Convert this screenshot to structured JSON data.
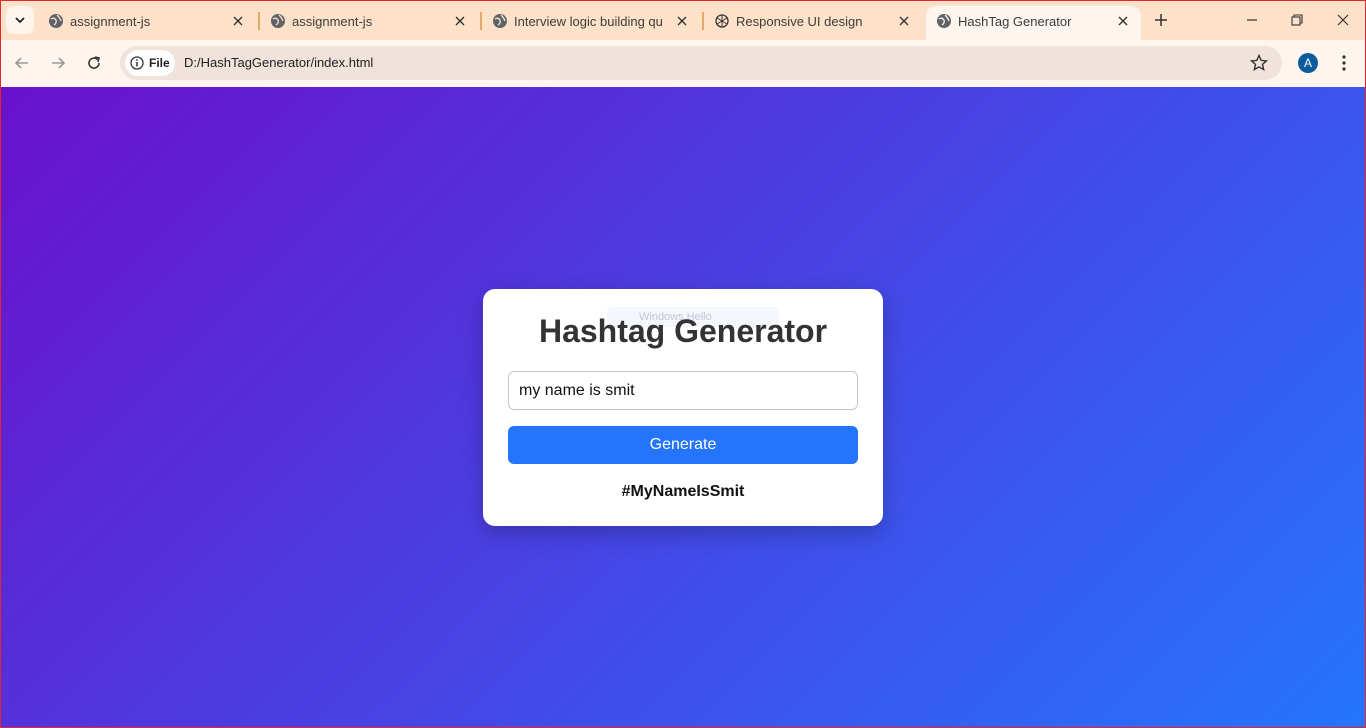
{
  "browser": {
    "tabs": [
      {
        "title": "assignment-js",
        "icon": "globe-icon",
        "active": false
      },
      {
        "title": "assignment-js",
        "icon": "globe-icon",
        "active": false
      },
      {
        "title": "Interview logic building questions",
        "icon": "globe-icon",
        "active": false
      },
      {
        "title": "Responsive UI design",
        "icon": "openai-icon",
        "active": false
      },
      {
        "title": "HashTag Generator",
        "icon": "globe-icon",
        "active": true
      }
    ],
    "address": {
      "chip_label": "File",
      "url": "D:/HashTagGenerator/index.html"
    },
    "profile_initial": "A",
    "colors": {
      "tabstrip": "#fde1c8",
      "toolbar": "#fff5ef",
      "frame_border": "#e3262b",
      "avatar": "#0d5c9e"
    }
  },
  "page": {
    "title": "Hashtag Generator",
    "input": {
      "value": "my name is smit",
      "placeholder": ""
    },
    "button_label": "Generate",
    "result": "#MyNameIsSmit",
    "ghost_tooltip": "Windows Hello",
    "colors": {
      "gradient_start": "#6a11cb",
      "gradient_end": "#2575fc",
      "button": "#2575fc",
      "card": "#ffffff"
    }
  }
}
